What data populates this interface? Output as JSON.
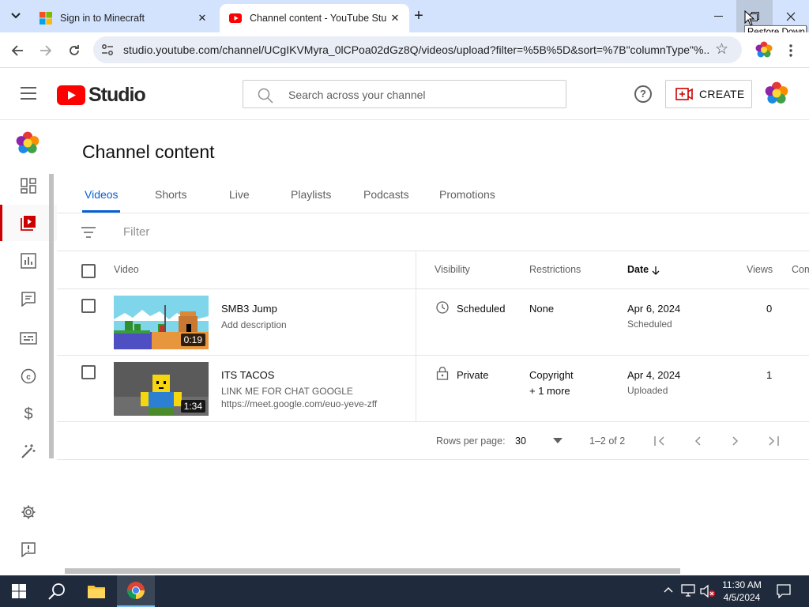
{
  "browser": {
    "tabs": [
      {
        "title": "Sign in to Minecraft",
        "active": false
      },
      {
        "title": "Channel content - YouTube Stu",
        "active": true
      }
    ],
    "url": "studio.youtube.com/channel/UCgIKVMyra_0lCPoa02dGz8Q/videos/upload?filter=%5B%5D&sort=%7B\"columnType\"%...",
    "tooltip": "Restore Down"
  },
  "header": {
    "logo_text": "Studio",
    "search_placeholder": "Search across your channel",
    "create_label": "CREATE"
  },
  "page": {
    "title": "Channel content",
    "tabs": [
      "Videos",
      "Shorts",
      "Live",
      "Playlists",
      "Podcasts",
      "Promotions"
    ],
    "active_tab": "Videos",
    "filter_placeholder": "Filter"
  },
  "table": {
    "columns": {
      "video": "Video",
      "visibility": "Visibility",
      "restrictions": "Restrictions",
      "date": "Date",
      "views": "Views",
      "comments": "Com"
    },
    "rows": [
      {
        "title": "SMB3 Jump",
        "description": "Add description",
        "duration": "0:19",
        "visibility": "Scheduled",
        "restrictions": "None",
        "restrictions_more": "",
        "date": "Apr 6, 2024",
        "date_status": "Scheduled",
        "views": "0"
      },
      {
        "title": "ITS TACOS",
        "description": "LINK ME FOR CHAT GOOGLE",
        "description2": "https://meet.google.com/euo-yeve-zff",
        "duration": "1:34",
        "visibility": "Private",
        "restrictions": "Copyright",
        "restrictions_more": "+ 1 more",
        "date": "Apr 4, 2024",
        "date_status": "Uploaded",
        "views": "1"
      }
    ],
    "pagination": {
      "rows_per_page_label": "Rows per page:",
      "rows_per_page": "30",
      "range": "1–2 of 2"
    }
  },
  "taskbar": {
    "time": "11:30 AM",
    "date": "4/5/2024"
  },
  "colors": {
    "youtube_red": "#ff0000",
    "active_blue": "#065fd4",
    "tab_strip": "#d3e3fd",
    "taskbar": "#1f2a3c"
  },
  "icons": [
    "menu-icon",
    "search-icon",
    "help-icon",
    "create-icon",
    "dashboard-icon",
    "content-icon",
    "analytics-icon",
    "comments-icon",
    "subtitles-icon",
    "copyright-icon",
    "earn-icon",
    "customization-icon",
    "settings-icon",
    "feedback-icon",
    "filter-icon",
    "sort-down-icon",
    "clock-icon",
    "lock-icon",
    "dropdown-icon",
    "first-page-icon",
    "prev-page-icon",
    "next-page-icon",
    "last-page-icon"
  ]
}
